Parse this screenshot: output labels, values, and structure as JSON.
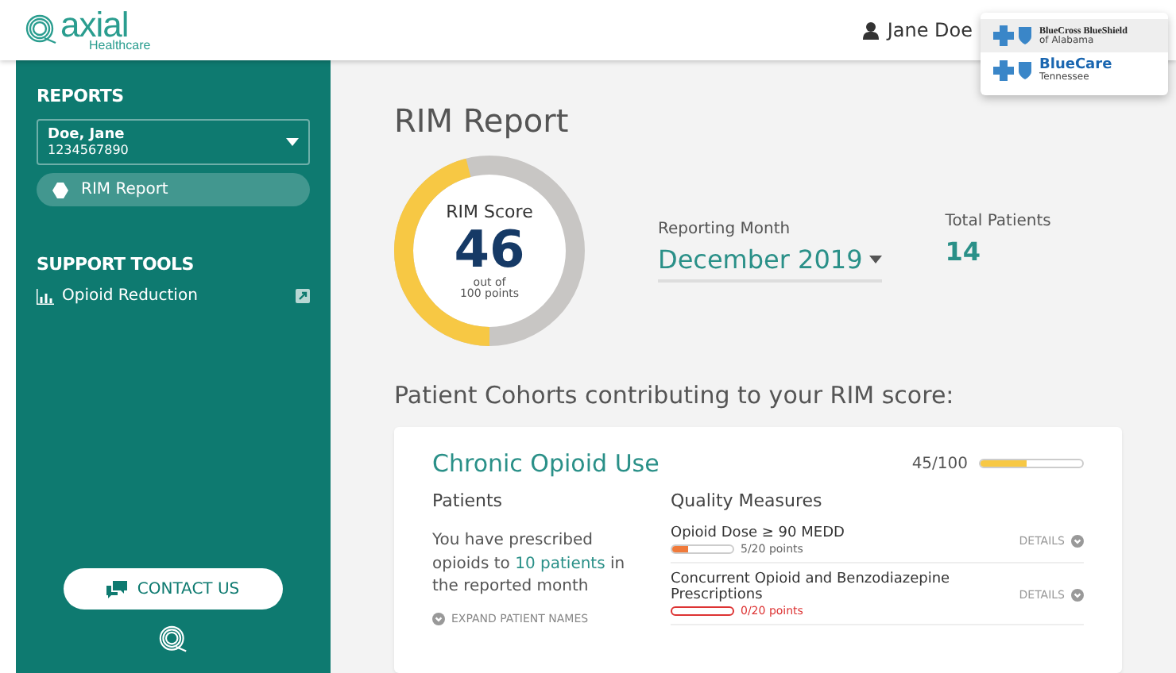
{
  "header": {
    "logo_word": "axial",
    "logo_sub": "Healthcare",
    "user": "Jane Doe"
  },
  "insurer_menu": [
    {
      "name": "BlueCross BlueShield",
      "sub": "of Alabama",
      "selected": true
    },
    {
      "name": "BlueCare",
      "sub": "Tennessee",
      "selected": false
    }
  ],
  "sidebar": {
    "reports_heading": "REPORTS",
    "patient_select": {
      "name": "Doe, Jane",
      "id": "1234567890"
    },
    "items": [
      {
        "label": "RIM Report",
        "selected": true
      }
    ],
    "support_heading": "SUPPORT TOOLS",
    "tools": [
      {
        "label": "Opioid Reduction"
      }
    ],
    "contact_button": "CONTACT US"
  },
  "page_title": "RIM Report",
  "score": {
    "label": "RIM Score",
    "value": "46",
    "sub1": "out of",
    "sub2": "100 points",
    "level": 0.46
  },
  "reporting_month": {
    "label": "Reporting Month",
    "value": "December 2019"
  },
  "total_patients": {
    "label": "Total Patients",
    "value": "14"
  },
  "cohorts_heading": "Patient Cohorts contributing to your RIM score:",
  "cohort": {
    "title": "Chronic Opioid Use",
    "score": "45/100",
    "level": 0.45,
    "patients_heading": "Patients",
    "patients_text": "You have prescribed opioids to **10 patients** in the reported month",
    "expand": "EXPAND PATIENT NAMES",
    "measures_heading": "Quality Measures",
    "measures": [
      {
        "name": "Opioid Dose ≥ 90 MEDD",
        "points": "5/20 points",
        "level": 0.25,
        "details": "DETAILS",
        "alert": false
      },
      {
        "name": "Concurrent Opioid and Benzodiazepine Prescriptions",
        "points": "0/20 points",
        "level": 0,
        "details": "DETAILS",
        "alert": true
      }
    ]
  }
}
